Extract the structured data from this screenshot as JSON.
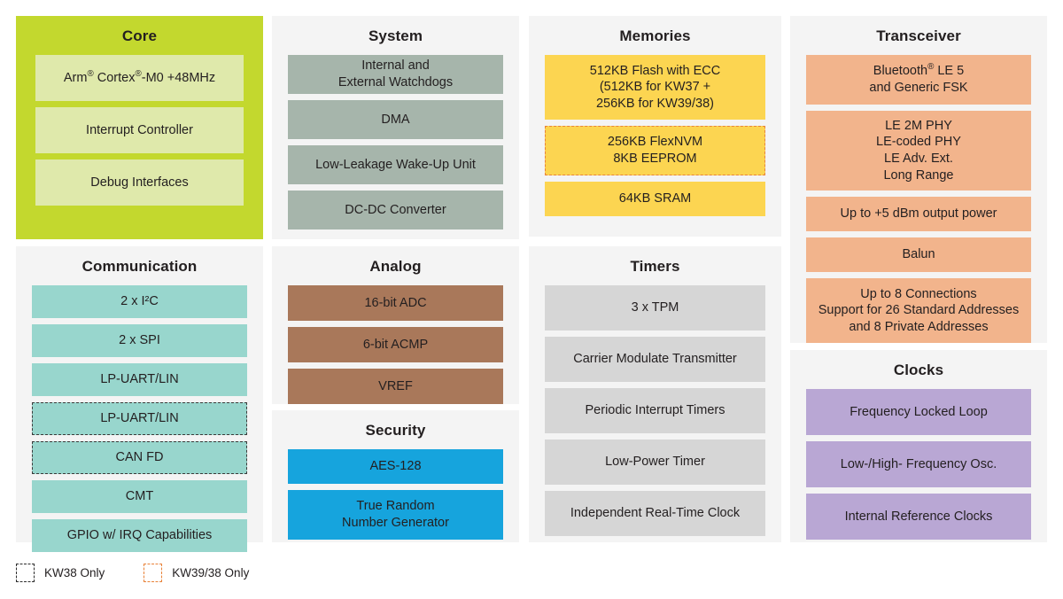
{
  "colors": {
    "core_panel": "#c3d82e",
    "core_block": "#dfe9ab",
    "panel_bg": "#f4f4f4",
    "system_block": "#a6b5ab",
    "memories_block": "#fcd551",
    "transceiver_block": "#f2b48c",
    "communication_block": "#98d6cd",
    "analog_block": "#a9785a",
    "security_block": "#16a4dd",
    "timers_block": "#d6d6d6",
    "clocks_block": "#b9a7d4",
    "dashed_kw38": "#3a3a3a",
    "dashed_kw3938": "#e8833a"
  },
  "panels": {
    "core": {
      "title": "Core",
      "blocks": [
        {
          "label": "Arm® Cortex®-M0 +48MHz",
          "variant": "solid"
        },
        {
          "label": "Interrupt Controller",
          "variant": "solid"
        },
        {
          "label": "Debug Interfaces",
          "variant": "solid"
        }
      ]
    },
    "system": {
      "title": "System",
      "blocks": [
        {
          "label": "Internal and\nExternal Watchdogs",
          "variant": "solid"
        },
        {
          "label": "DMA",
          "variant": "solid"
        },
        {
          "label": "Low-Leakage Wake-Up Unit",
          "variant": "solid"
        },
        {
          "label": "DC-DC Converter",
          "variant": "solid"
        }
      ]
    },
    "memories": {
      "title": "Memories",
      "blocks": [
        {
          "label": "512KB Flash with ECC\n(512KB for KW37 +\n256KB for KW39/38)",
          "variant": "solid"
        },
        {
          "label": "256KB FlexNVM\n8KB EEPROM",
          "variant": "dashed-orange"
        },
        {
          "label": "64KB SRAM",
          "variant": "solid"
        }
      ]
    },
    "transceiver": {
      "title": "Transceiver",
      "blocks": [
        {
          "label": "Bluetooth® LE 5\nand Generic FSK",
          "variant": "solid"
        },
        {
          "label": "LE 2M PHY\nLE-coded PHY\nLE Adv. Ext.\nLong Range",
          "variant": "solid"
        },
        {
          "label": "Up to +5 dBm output power",
          "variant": "solid"
        },
        {
          "label": "Balun",
          "variant": "solid"
        },
        {
          "label": "Up to 8 Connections\nSupport for 26 Standard Addresses\nand 8 Private Addresses",
          "variant": "solid"
        }
      ]
    },
    "communication": {
      "title": "Communication",
      "blocks": [
        {
          "label": "2 x I²C",
          "variant": "solid"
        },
        {
          "label": "2 x SPI",
          "variant": "solid"
        },
        {
          "label": "LP-UART/LIN",
          "variant": "solid"
        },
        {
          "label": "LP-UART/LIN",
          "variant": "dashed-black"
        },
        {
          "label": "CAN FD",
          "variant": "dashed-black"
        },
        {
          "label": "CMT",
          "variant": "solid"
        },
        {
          "label": "GPIO w/ IRQ Capabilities",
          "variant": "solid"
        }
      ]
    },
    "analog": {
      "title": "Analog",
      "blocks": [
        {
          "label": "16-bit ADC",
          "variant": "solid"
        },
        {
          "label": "6-bit ACMP",
          "variant": "solid"
        },
        {
          "label": "VREF",
          "variant": "solid"
        }
      ]
    },
    "security": {
      "title": "Security",
      "blocks": [
        {
          "label": "AES-128",
          "variant": "solid"
        },
        {
          "label": "True Random\nNumber Generator",
          "variant": "solid"
        }
      ]
    },
    "timers": {
      "title": "Timers",
      "blocks": [
        {
          "label": "3 x TPM",
          "variant": "solid"
        },
        {
          "label": "Carrier Modulate Transmitter",
          "variant": "solid"
        },
        {
          "label": "Periodic Interrupt Timers",
          "variant": "solid"
        },
        {
          "label": "Low-Power Timer",
          "variant": "solid"
        },
        {
          "label": "Independent Real-Time Clock",
          "variant": "solid"
        }
      ]
    },
    "clocks": {
      "title": "Clocks",
      "blocks": [
        {
          "label": "Frequency Locked Loop",
          "variant": "solid"
        },
        {
          "label": "Low-/High- Frequency Osc.",
          "variant": "solid"
        },
        {
          "label": "Internal Reference Clocks",
          "variant": "solid"
        }
      ]
    }
  },
  "legend": [
    {
      "label": "KW38 Only",
      "style": "black"
    },
    {
      "label": "KW39/38 Only",
      "style": "orange"
    }
  ]
}
